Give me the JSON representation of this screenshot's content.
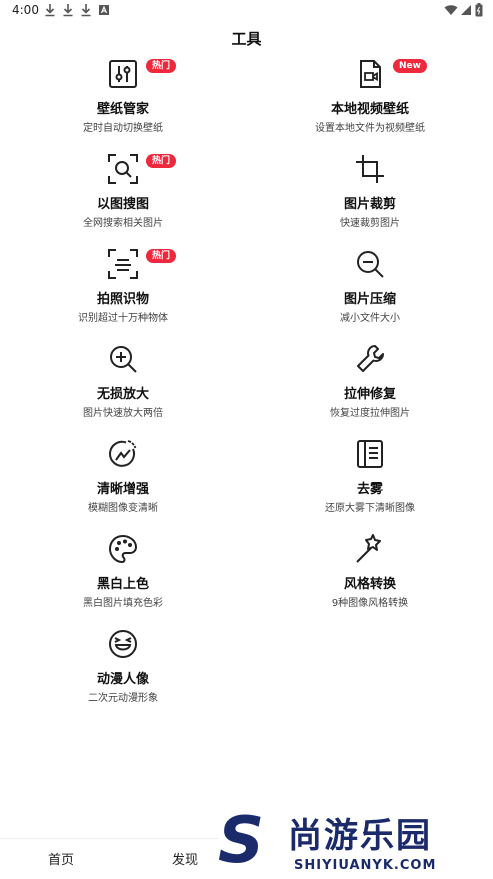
{
  "status_bar": {
    "time": "4:00"
  },
  "page": {
    "title": "工具"
  },
  "tools": [
    {
      "name": "壁纸管家",
      "desc": "定时自动切换壁纸",
      "badge": "热门"
    },
    {
      "name": "本地视频壁纸",
      "desc": "设置本地文件为视频壁纸",
      "badge": "New"
    },
    {
      "name": "以图搜图",
      "desc": "全网搜索相关图片",
      "badge": "热门"
    },
    {
      "name": "图片裁剪",
      "desc": "快速裁剪图片",
      "badge": ""
    },
    {
      "name": "拍照识物",
      "desc": "识别超过十万种物体",
      "badge": "热门"
    },
    {
      "name": "图片压缩",
      "desc": "减小文件大小",
      "badge": ""
    },
    {
      "name": "无损放大",
      "desc": "图片快速放大两倍",
      "badge": ""
    },
    {
      "name": "拉伸修复",
      "desc": "恢复过度拉伸图片",
      "badge": ""
    },
    {
      "name": "清晰增强",
      "desc": "模糊图像变清晰",
      "badge": ""
    },
    {
      "name": "去雾",
      "desc": "还原大雾下清晰图像",
      "badge": ""
    },
    {
      "name": "黑白上色",
      "desc": "黑白图片填充色彩",
      "badge": ""
    },
    {
      "name": "风格转换",
      "desc": "9种图像风格转换",
      "badge": ""
    },
    {
      "name": "动漫人像",
      "desc": "二次元动漫形象",
      "badge": ""
    }
  ],
  "bottom_nav": {
    "home": "首页",
    "discover": "发现"
  },
  "watermark": {
    "letter": "S",
    "cn": "尚游乐园",
    "en": "SHIYIUANYK.COM"
  },
  "colors": {
    "badge": "#f0283c",
    "watermark": "#1b2a6b"
  }
}
